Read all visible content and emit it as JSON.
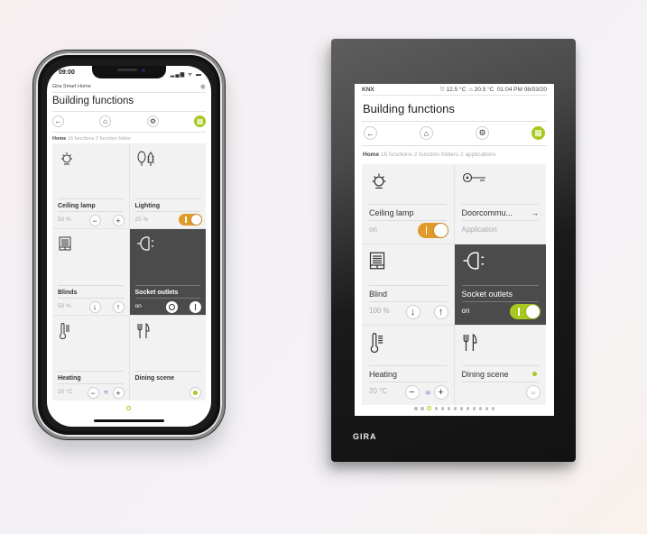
{
  "colors": {
    "accent": "#a7c81e",
    "orange": "#e09a2a",
    "dark_tile": "#4b4b4b",
    "tile": "#f2f2f2"
  },
  "phone": {
    "time": "09:00",
    "status_icons": [
      "signal-icon",
      "wifi-icon",
      "battery-icon"
    ],
    "status_glyphs": "▂▄▆ ᯤ ▬",
    "app_name": "Gira Smart Home",
    "title": "Building functions",
    "nav": [
      {
        "name": "back",
        "glyph": "←"
      },
      {
        "name": "home",
        "glyph": "⌂"
      },
      {
        "name": "settings",
        "glyph": "⚙"
      },
      {
        "name": "grid-view",
        "glyph": "▦",
        "active": true
      }
    ],
    "breadcrumb": {
      "home": "Home",
      "info": "16 functions 2 function folder"
    },
    "tiles": [
      {
        "name": "Ceiling lamp",
        "icon": "bulb",
        "glyph": "💡",
        "value": "50 %",
        "controls": "minus-plus"
      },
      {
        "name": "Lighting",
        "icon": "trees",
        "glyph": "⚘",
        "value": "25 %",
        "controls": "toggle-on"
      },
      {
        "name": "Blinds",
        "icon": "blind",
        "glyph": "▤",
        "value": "50 %",
        "controls": "down-up"
      },
      {
        "name": "Socket outlets",
        "icon": "plug",
        "glyph": "⊣",
        "value": "on",
        "controls": "off-on",
        "dark": true
      },
      {
        "name": "Heating",
        "icon": "thermometer",
        "glyph": "🌡",
        "value": "20 °C",
        "controls": "minus-heat-plus"
      },
      {
        "name": "Dining scene",
        "icon": "fork-knife",
        "glyph": "🍴",
        "value": "",
        "controls": "scene-dot"
      }
    ],
    "page_dots": 1,
    "active_page": 1
  },
  "panel": {
    "status": {
      "system": "KNX",
      "outdoor_temp": "12.5 °C",
      "indoor_temp": "20.5 °C",
      "time": "01:04 PM",
      "date": "08/03/20"
    },
    "title": "Building functions",
    "nav": [
      {
        "name": "back",
        "glyph": "←"
      },
      {
        "name": "home",
        "glyph": "⌂"
      },
      {
        "name": "settings",
        "glyph": "⚙"
      },
      {
        "name": "grid-view",
        "glyph": "▦",
        "active": true
      }
    ],
    "breadcrumb": {
      "home": "Home",
      "info": "16 functions 2 function folders 2 applications"
    },
    "tiles": [
      {
        "name": "Ceiling lamp",
        "icon": "bulb",
        "glyph": "💡",
        "value": "on",
        "controls": "toggle-orange"
      },
      {
        "name": "Doorcommu...",
        "icon": "key",
        "glyph": "⚿",
        "value": "Application",
        "controls": "arrow"
      },
      {
        "name": "Blind",
        "icon": "blind",
        "glyph": "▤",
        "value": "100 %",
        "controls": "down-up"
      },
      {
        "name": "Socket outlets",
        "icon": "plug",
        "glyph": "⊣",
        "value": "on",
        "controls": "toggle-green",
        "dark": true
      },
      {
        "name": "Heating",
        "icon": "thermometer",
        "glyph": "🌡",
        "value": "20 °C",
        "controls": "minus-heat-plus"
      },
      {
        "name": "Dining scene",
        "icon": "fork-knife",
        "glyph": "🍴",
        "value": "",
        "controls": "scene"
      }
    ],
    "page_dots": 13,
    "active_page": 3,
    "brand": "GIRA"
  },
  "glyphs": {
    "minus": "−",
    "plus": "+",
    "down": "↓",
    "up": "↑",
    "arrow_right": "→",
    "heat": "≋",
    "eye": "◉",
    "outdoor": "⛆",
    "indoor": "⌂"
  }
}
